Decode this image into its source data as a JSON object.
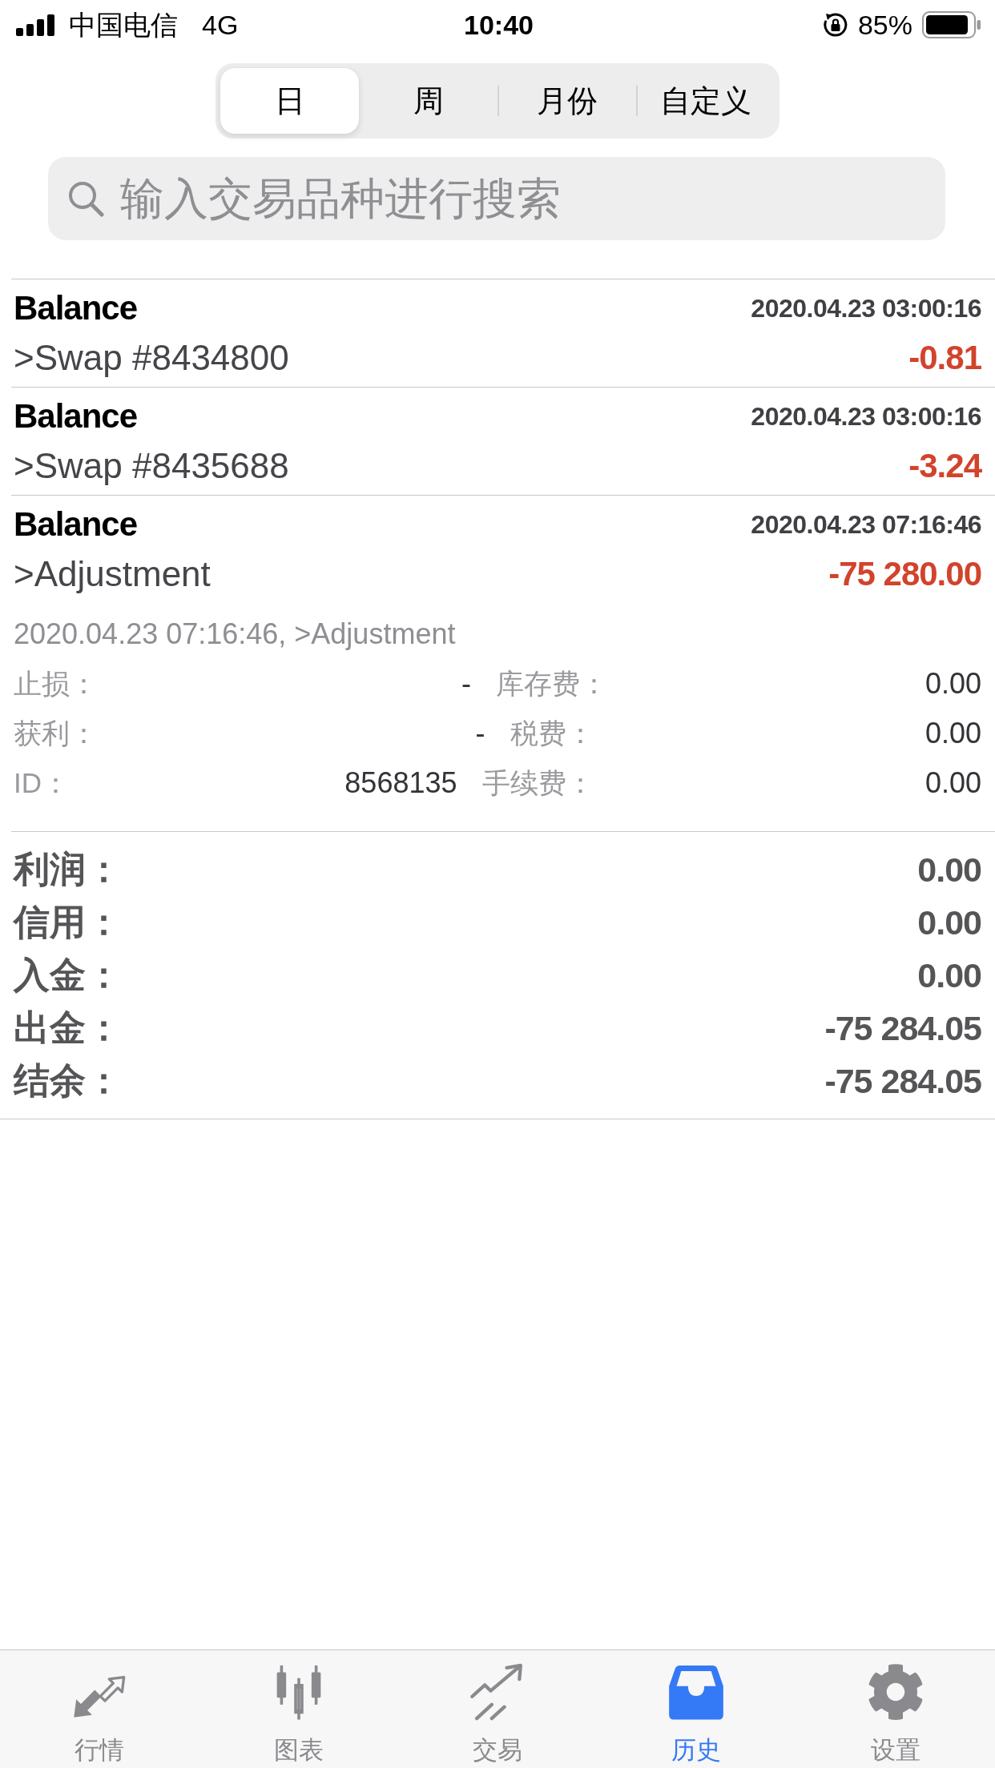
{
  "status_bar": {
    "carrier": "中国电信",
    "network": "4G",
    "time": "10:40",
    "battery": "85%"
  },
  "period_tabs": [
    {
      "label": "日",
      "selected": true
    },
    {
      "label": "周",
      "selected": false
    },
    {
      "label": "月份",
      "selected": false
    },
    {
      "label": "自定义",
      "selected": false
    }
  ],
  "search": {
    "placeholder": "输入交易品种进行搜索"
  },
  "deals": [
    {
      "type": "Balance",
      "time": "2020.04.23 03:00:16",
      "comment": ">Swap #8434800",
      "amount": "-0.81"
    },
    {
      "type": "Balance",
      "time": "2020.04.23 03:00:16",
      "comment": ">Swap #8435688",
      "amount": "-3.24"
    },
    {
      "type": "Balance",
      "time": "2020.04.23 07:16:46",
      "comment": ">Adjustment",
      "amount": "-75 280.00",
      "details": {
        "summary": "2020.04.23 07:16:46, >Adjustment",
        "rows": [
          {
            "cells": [
              "止损：",
              "-",
              "库存费：",
              "0.00"
            ]
          },
          {
            "cells": [
              "获利：",
              "-",
              "税费：",
              "0.00"
            ]
          },
          {
            "cells": [
              "ID：",
              "8568135",
              "手续费：",
              "0.00"
            ]
          }
        ]
      }
    }
  ],
  "totals": [
    {
      "label": "利润：",
      "value": "0.00"
    },
    {
      "label": "信用：",
      "value": "0.00"
    },
    {
      "label": "入金：",
      "value": "0.00"
    },
    {
      "label": "出金：",
      "value": "-75 284.05"
    },
    {
      "label": "结余：",
      "value": "-75 284.05"
    }
  ],
  "tab_bar": [
    {
      "label": "行情",
      "selected": false
    },
    {
      "label": "图表",
      "selected": false
    },
    {
      "label": "交易",
      "selected": false
    },
    {
      "label": "历史",
      "selected": true
    },
    {
      "label": "设置",
      "selected": false
    }
  ]
}
